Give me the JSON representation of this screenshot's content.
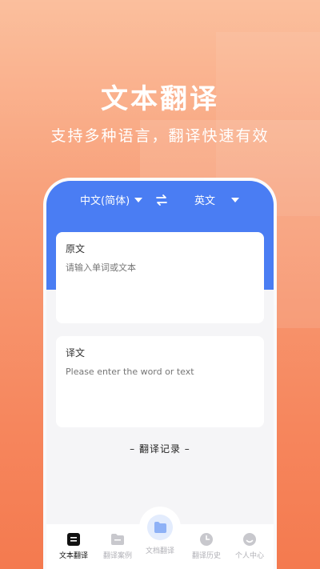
{
  "hero": {
    "title": "文本翻译",
    "subtitle": "支持多种语言，翻译快速有效"
  },
  "lang_bar": {
    "source_lang": "中文(简体)",
    "target_lang": "英文"
  },
  "source_card": {
    "label": "原文",
    "placeholder": "请输入单词或文本"
  },
  "target_card": {
    "label": "译文",
    "placeholder": "Please enter the word or text"
  },
  "history_link": "– 翻译记录 –",
  "tabs": [
    {
      "label": "文本翻译",
      "icon": "text-translate-icon",
      "active": true
    },
    {
      "label": "翻译案例",
      "icon": "folder-icon",
      "active": false
    },
    {
      "label": "文档翻译",
      "icon": "document-icon",
      "active": false
    },
    {
      "label": "翻译历史",
      "icon": "clock-icon",
      "active": false
    },
    {
      "label": "个人中心",
      "icon": "smiley-icon",
      "active": false
    }
  ],
  "colors": {
    "accent": "#4a7df3",
    "background_top": "#fbbf9d",
    "background_bottom": "#f47a4f"
  }
}
